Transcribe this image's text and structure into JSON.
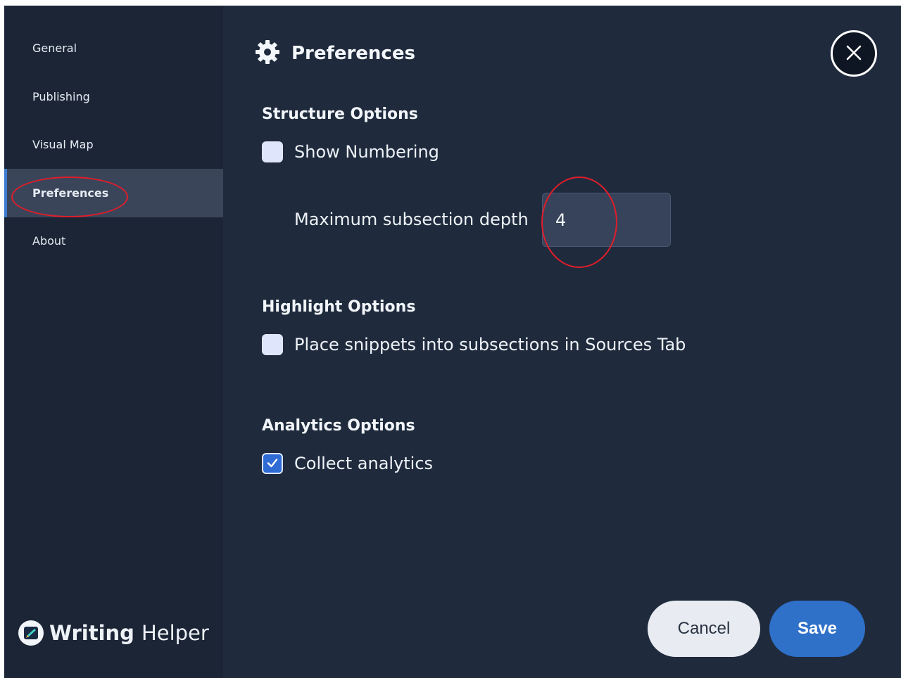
{
  "sidebar": {
    "items": [
      {
        "label": "General"
      },
      {
        "label": "Publishing"
      },
      {
        "label": "Visual Map"
      },
      {
        "label": "Preferences"
      },
      {
        "label": "About"
      }
    ],
    "active_item": "Preferences",
    "brand": {
      "word1": "Writing",
      "word2": "Helper"
    }
  },
  "header": {
    "title": "Preferences",
    "icon": "gear-icon"
  },
  "sections": {
    "structure": {
      "title": "Structure Options",
      "show_numbering_label": "Show Numbering",
      "show_numbering_checked": false,
      "max_depth_label": "Maximum subsection depth",
      "max_depth_value": "4"
    },
    "highlight": {
      "title": "Highlight Options",
      "snippets_label": "Place snippets into subsections in Sources Tab",
      "snippets_checked": false
    },
    "analytics": {
      "title": "Analytics Options",
      "collect_label": "Collect analytics",
      "collect_checked": true
    }
  },
  "footer": {
    "cancel_label": "Cancel",
    "save_label": "Save"
  },
  "colors": {
    "accent": "#2f70c9",
    "annotation": "#e11d2a",
    "background": "#1f2b3d"
  }
}
